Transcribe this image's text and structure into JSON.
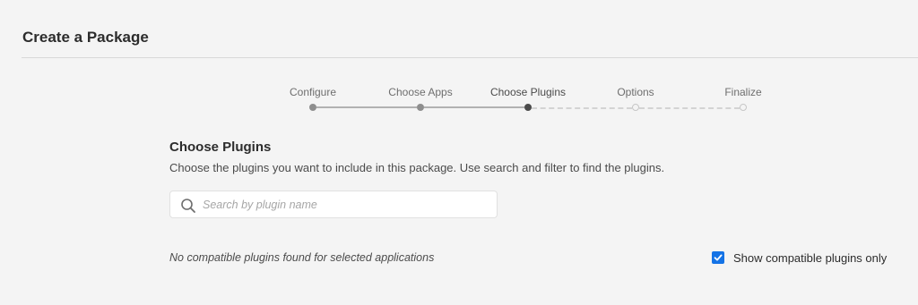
{
  "page": {
    "title": "Create a Package"
  },
  "stepper": {
    "current_step_index": 2,
    "steps": [
      {
        "label": "Configure",
        "state": "done"
      },
      {
        "label": "Choose Apps",
        "state": "done"
      },
      {
        "label": "Choose Plugins",
        "state": "current"
      },
      {
        "label": "Options",
        "state": "todo"
      },
      {
        "label": "Finalize",
        "state": "todo"
      }
    ]
  },
  "section": {
    "title": "Choose Plugins",
    "description": "Choose the plugins you want to include in this package. Use search and filter to find the plugins."
  },
  "search": {
    "icon": "search-icon",
    "placeholder": "Search by plugin name",
    "value": ""
  },
  "results": {
    "empty_message": "No compatible plugins found for selected applications"
  },
  "filter": {
    "compatible_only_label": "Show compatible plugins only",
    "compatible_only_checked": true
  },
  "colors": {
    "background": "#f4f4f4",
    "accent": "#1473e6",
    "step_done": "#8e8e8e",
    "step_current": "#4b4b4b",
    "step_todo": "#c6c6c6"
  }
}
